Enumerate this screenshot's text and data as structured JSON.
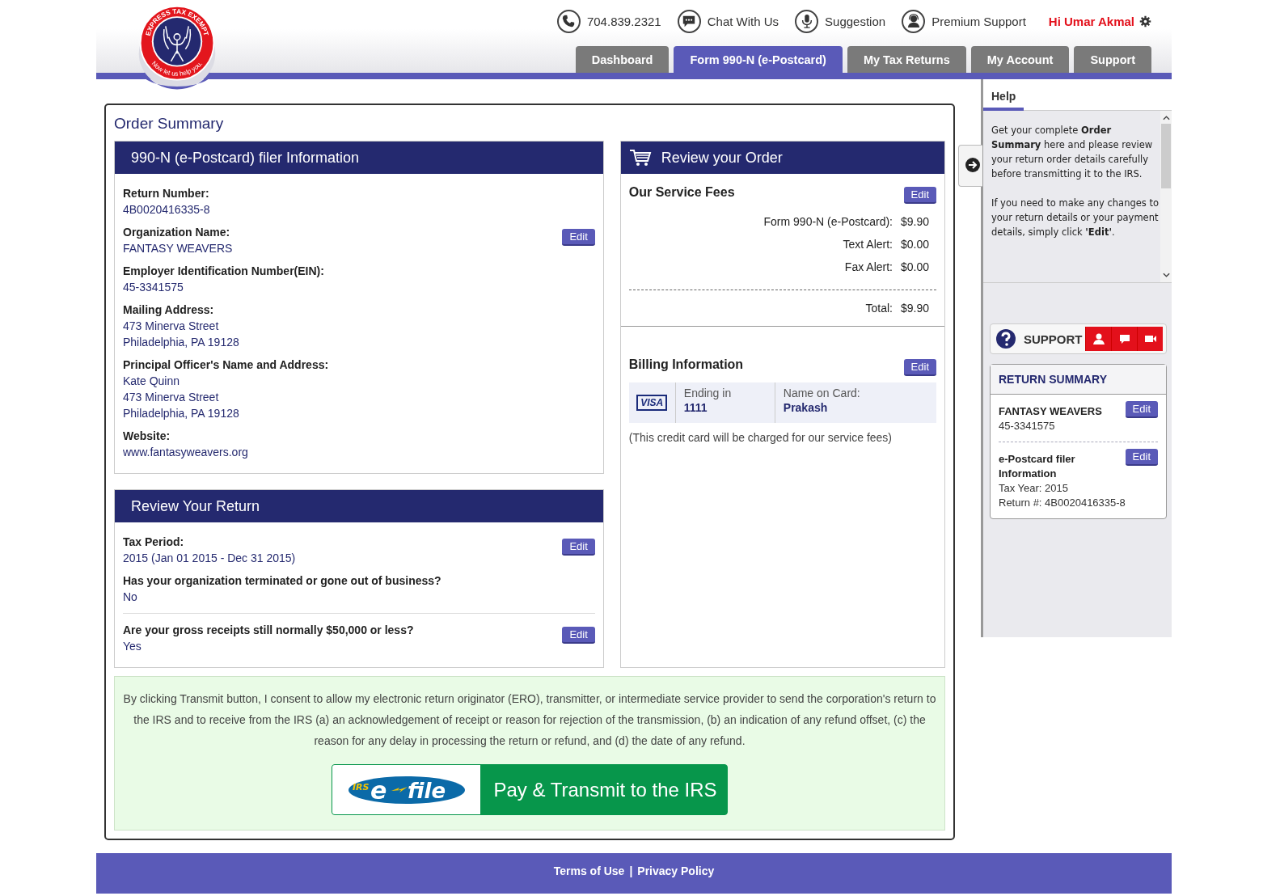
{
  "logo": {
    "arc_text": "EXPRESS TAX EXEMPT",
    "tagline": "Now let us help you."
  },
  "top_links": [
    {
      "kind": "phone",
      "label": "704.839.2321"
    },
    {
      "kind": "chat",
      "label": "Chat With Us"
    },
    {
      "kind": "mic",
      "label": "Suggestion"
    },
    {
      "kind": "agent",
      "label": "Premium Support"
    }
  ],
  "greeting": "Hi Umar Akmal",
  "tabs": [
    {
      "label": "Dashboard",
      "selected": false
    },
    {
      "label": "Form 990-N (e-Postcard)",
      "selected": true
    },
    {
      "label": "My Tax Returns",
      "selected": false
    },
    {
      "label": "My Account",
      "selected": false
    },
    {
      "label": "Support",
      "selected": false
    }
  ],
  "order_summary": {
    "title": "Order Summary",
    "filer_info": {
      "title": "990-N (e-Postcard) filer Information",
      "fields": [
        {
          "label": "Return Number:",
          "lines": [
            "4B0020416335-8"
          ]
        },
        {
          "label": "Organization Name:",
          "lines": [
            "FANTASY WEAVERS"
          ],
          "edit": "Edit"
        },
        {
          "label": "Employer Identification Number(EIN):",
          "lines": [
            "45-3341575"
          ]
        },
        {
          "label": "Mailing Address:",
          "lines": [
            "473 Minerva Street",
            "Philadelphia, PA 19128"
          ]
        },
        {
          "label": "Principal Officer's Name and Address:",
          "lines": [
            "Kate Quinn",
            "473 Minerva Street",
            "Philadelphia, PA 19128"
          ]
        },
        {
          "label": "Website:",
          "lines": [
            "www.fantasyweavers.org"
          ]
        }
      ]
    },
    "review_return": {
      "title": "Review Your Return",
      "groups": [
        [
          {
            "label": "Tax Period:",
            "lines": [
              "2015 (Jan 01 2015 - Dec 31 2015)"
            ],
            "edit": "Edit"
          },
          {
            "label": "Has your organization terminated or gone out of business?",
            "lines": [
              "No"
            ]
          }
        ],
        [
          {
            "label": "Are your gross receipts still normally $50,000 or less?",
            "lines": [
              "Yes"
            ],
            "edit": "Edit"
          }
        ]
      ]
    },
    "review_order": {
      "title": "Review your Order",
      "fees_title": "Our Service Fees",
      "fees_edit": "Edit",
      "fees": [
        {
          "label": "Form 990-N (e-Postcard):",
          "amount": "$9.90"
        },
        {
          "label": "Text Alert:",
          "amount": "$0.00"
        },
        {
          "label": "Fax Alert:",
          "amount": "$0.00"
        }
      ],
      "total_label": "Total:",
      "total": "$9.90",
      "billing_title": "Billing Information",
      "billing_edit": "Edit",
      "card": {
        "brand": "VISA",
        "ending_label": "Ending in",
        "ending": "1111",
        "name_label": "Name on Card:",
        "name": "Prakash"
      },
      "note": "(This credit card will be charged for our service fees)"
    },
    "consent": "By clicking Transmit button, I consent to allow my electronic return originator (ERO), transmitter, or intermediate service provider to send the corporation's return to the IRS and to receive from the IRS (a) an acknowledgement of receipt or reason for rejection of the transmission, (b) an indication of any refund offset, (c) the reason for any delay in processing the return or refund, and (d) the date of any refund.",
    "pay_button": {
      "logo_small": "IRS",
      "logo_e": "e",
      "logo_file": "file",
      "label": "Pay & Transmit to the IRS"
    }
  },
  "sidebar": {
    "help_tab": "Help",
    "help_paragraphs": [
      "Get your complete **Order Summary** here and please review your return order details carefully before transmitting it to the IRS.",
      "If you need to make any changes to your return details or your payment details, simply click **'Edit'**."
    ],
    "support_label": "SUPPORT",
    "support_buttons": [
      {
        "kind": "person"
      },
      {
        "kind": "chat"
      },
      {
        "kind": "video"
      }
    ],
    "return_summary": {
      "title": "RETURN SUMMARY",
      "items": [
        {
          "title": "FANTASY WEAVERS",
          "lines": [
            "45-3341575"
          ],
          "edit": "Edit"
        },
        {
          "title": "e-Postcard filer Information",
          "lines": [
            "Tax Year: 2015",
            "Return #: 4B0020416335-8"
          ],
          "edit": "Edit"
        }
      ]
    }
  },
  "footer": {
    "links": [
      "Terms of Use",
      "Privacy Policy"
    ],
    "separator": "|"
  }
}
